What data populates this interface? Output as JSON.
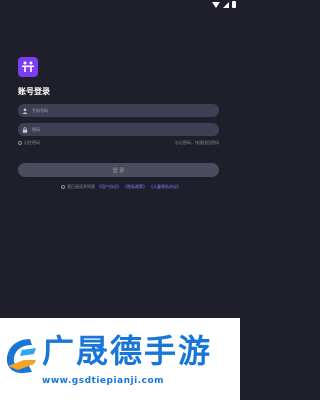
{
  "screen": {
    "title": "账号登录",
    "phone_placeholder": "手机号码",
    "password_placeholder": "密码",
    "remember_label": "记住密码",
    "forgot_label": "忘记密码，快速找回密码",
    "login_button": "登 录",
    "agree_prefix": "我已阅读并同意",
    "links": [
      "《用户协议》",
      "《隐私政策》",
      "《儿童隐私协议》"
    ],
    "logo_icon": "stick-figures-logo-icon",
    "accent_color": "#7b3cf2"
  },
  "status_bar": {
    "icons": [
      "wifi-icon",
      "signal-icon",
      "battery-icon"
    ]
  },
  "watermark": {
    "title": "广晟德手游",
    "url": "www.gsdtiepianji.com",
    "color": "#1776d8"
  }
}
